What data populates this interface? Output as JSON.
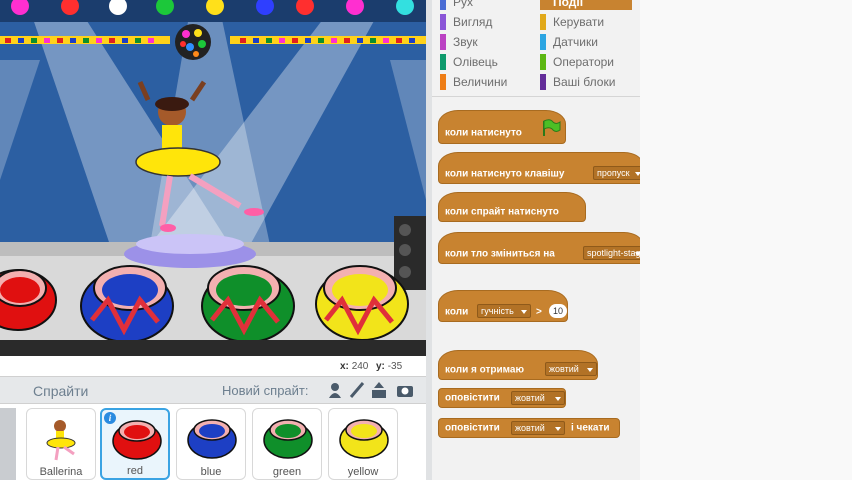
{
  "stage": {
    "coords": {
      "x_label": "x:",
      "x_value": "240",
      "y_label": "y:",
      "y_value": "-35"
    }
  },
  "sprites": {
    "header_title": "Спрайти",
    "new_sprite_label": "Новий спрайт:",
    "info_badge": "i",
    "items": [
      {
        "name": "Ballerina",
        "selected": false
      },
      {
        "name": "red",
        "selected": true,
        "color": "#e01010"
      },
      {
        "name": "blue",
        "selected": false,
        "color": "#1d3fc4"
      },
      {
        "name": "green",
        "selected": false,
        "color": "#0f8f2a"
      },
      {
        "name": "yellow",
        "selected": false,
        "color": "#f2e41a"
      }
    ]
  },
  "palette": {
    "categories": [
      {
        "label": "Рух",
        "color": "#4a6cd4",
        "selected": false
      },
      {
        "label": "Події",
        "color": "#c88330",
        "selected": true
      },
      {
        "label": "Вигляд",
        "color": "#8a55d7",
        "selected": false
      },
      {
        "label": "Керувати",
        "color": "#e1a91a",
        "selected": false
      },
      {
        "label": "Звук",
        "color": "#bb42c3",
        "selected": false
      },
      {
        "label": "Датчики",
        "color": "#2ca5e2",
        "selected": false
      },
      {
        "label": "Олівець",
        "color": "#0e9a6c",
        "selected": false
      },
      {
        "label": "Оператори",
        "color": "#5cb712",
        "selected": false
      },
      {
        "label": "Величини",
        "color": "#ee7d16",
        "selected": false
      },
      {
        "label": "Ваші блоки",
        "color": "#632d99",
        "selected": false
      }
    ],
    "blocks": {
      "flag_clicked": "коли натиснуто",
      "key_pressed": "коли натиснуто клавішу",
      "key_value": "пропуск",
      "sprite_clicked": "коли спрайт натиснуто",
      "backdrop_switch": "коли тло зміниться на",
      "backdrop_value": "spotlight-stage",
      "when_label": "коли",
      "sensor_value": "гучність",
      "gt_symbol": ">",
      "threshold": "10",
      "receive": "коли я отримаю",
      "receive_value": "жовтий",
      "broadcast": "оповістити",
      "broadcast_value": "жовтий",
      "broadcast_wait": "оповістити",
      "broadcast_wait_value": "жовтий",
      "broadcast_wait_suffix": "і чекати"
    }
  }
}
